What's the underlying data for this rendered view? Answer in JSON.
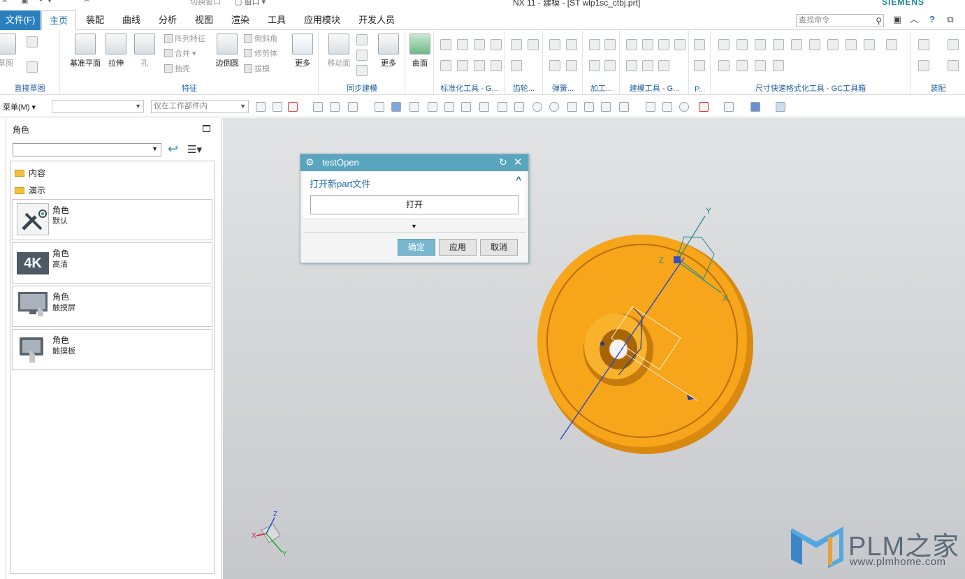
{
  "titlebar": {
    "title": "NX 11 - 建模 - [ST wlp1sc_ctbj.prt]",
    "brand": "SIEMENS",
    "switch_window": "切换窗口",
    "window": "窗口"
  },
  "menubar": {
    "file": "文件(F)",
    "tabs": [
      "主页",
      "装配",
      "曲线",
      "分析",
      "视图",
      "渲染",
      "工具",
      "应用模块",
      "开发人员"
    ],
    "search_placeholder": "查找命令"
  },
  "ribbon": {
    "groups": [
      {
        "label": "直接草图"
      },
      {
        "label": "特征"
      },
      {
        "label": "同步建模"
      },
      {
        "label": "标准化工具 - G..."
      },
      {
        "label": "齿轮..."
      },
      {
        "label": "弹簧..."
      },
      {
        "label": "加工..."
      },
      {
        "label": "建模工具 - G..."
      },
      {
        "label": "P..."
      },
      {
        "label": "尺寸快速格式化工具 - GC工具箱"
      },
      {
        "label": "装配"
      }
    ],
    "big_buttons": {
      "datum_plane": "基准平面",
      "extrude": "拉伸",
      "hole": "孔",
      "edge_blend": "边倒圆",
      "more1": "更多",
      "move_face": "移动面",
      "more2": "更多",
      "surface": "曲面",
      "sketch": "草图"
    },
    "small_buttons": {
      "pattern": "阵列特征",
      "unite": "合并",
      "shell": "抽壳",
      "chamfer": "倒斜角",
      "trim_body": "修剪体",
      "draft": "拔模"
    }
  },
  "toolbar2": {
    "menu": "菜单(M)",
    "filter_placeholder": "",
    "scope": "仅在工作部件内"
  },
  "panel": {
    "title": "角色",
    "folders": [
      "内容",
      "演示"
    ],
    "cards": [
      {
        "title": "角色",
        "sub": "默认",
        "icon": "tools-icon"
      },
      {
        "title": "角色",
        "sub": "高清",
        "icon": "4k-icon"
      },
      {
        "title": "角色",
        "sub": "触摸屏",
        "icon": "touchscreen-icon"
      },
      {
        "title": "角色",
        "sub": "触摸板",
        "icon": "touchpad-icon"
      }
    ],
    "thumb_4k": "4K"
  },
  "dialog": {
    "title": "testOpen",
    "section_title": "打开新part文件",
    "open_button": "打开",
    "ok": "确定",
    "apply": "应用",
    "cancel": "取消"
  },
  "viewport": {
    "csys_labels": {
      "x": "X",
      "y": "Y",
      "z": "Z"
    },
    "part_color": "#f7a51a"
  },
  "watermark": {
    "brand": "PLM之家",
    "url": "www.plmhome.com"
  }
}
